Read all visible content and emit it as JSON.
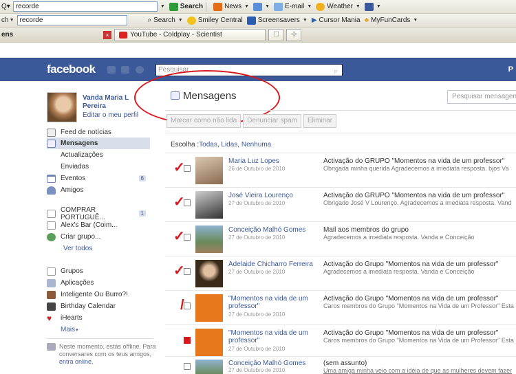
{
  "browser": {
    "toolbar1": {
      "search_value": "recorde",
      "search_btn": "Search",
      "news": "News",
      "email": "E-mail",
      "weather": "Weather"
    },
    "toolbar2": {
      "label_prefix": "ch",
      "search_value": "recorde",
      "search_btn": "Search",
      "smiley": "Smiley Central",
      "screensavers": "Screensavers",
      "cursor": "Cursor Mania",
      "myfun": "MyFunCards"
    },
    "tabbar": {
      "left_text": "ens",
      "tab_title": "YouTube - Coldplay - Scientist"
    },
    "colors": {
      "accent": "#3b5998",
      "highlight_red": "#d9181c"
    }
  },
  "facebook": {
    "logo": "facebook",
    "search_placeholder": "Pesquisar",
    "right_text": "P"
  },
  "profile": {
    "name": "Vanda Maria L Pereira",
    "edit": "Editar o meu perfil"
  },
  "sidebar": {
    "items": [
      {
        "label": "Feed de notícias",
        "icon": "newsfeed-icon"
      },
      {
        "label": "Mensagens",
        "icon": "messages-icon"
      },
      {
        "label": "Actualizações"
      },
      {
        "label": "Enviadas"
      },
      {
        "label": "Eventos",
        "icon": "calendar-icon",
        "count": "6"
      },
      {
        "label": "Amigos",
        "icon": "friends-icon"
      }
    ],
    "groups": [
      {
        "label": "COMPRAR PORTUGUÊ...",
        "count": "1"
      },
      {
        "label": "Alex's Bar (Coim..."
      },
      {
        "label": "Criar grupo..."
      }
    ],
    "see_all": "Ver todos",
    "apps": [
      {
        "label": "Grupos"
      },
      {
        "label": "Aplicações"
      },
      {
        "label": "Inteligente Ou Burro?!"
      },
      {
        "label": "Birthday Calendar"
      },
      {
        "label": "iHearts"
      }
    ],
    "more": "Mais",
    "offline_text": "Neste momento, estás offline. Para conversares com os teus amigos, ",
    "offline_link": "entra online."
  },
  "main": {
    "title": "Mensagens",
    "search_placeholder": "Pesquisar mensagens",
    "actions": [
      "Marcar como não lida",
      "Denunciar spam",
      "Eliminar"
    ],
    "choose_label": "Escolha :",
    "choose_all": "Todas",
    "choose_read": "Lidas",
    "choose_none": "Nenhuma",
    "messages": [
      {
        "sender": "Maria Luz Lopes",
        "date": "26 de Outubro de 2010",
        "subject": "Activação do GRUPO \"Momentos na vida de um professor\"",
        "snippet": "Obrigada minha querida Agradecemos a imediata resposta. bjos Va"
      },
      {
        "sender": "José Vieira Lourenço",
        "date": "27 de Outubro de 2010",
        "subject": "Activação do GRUPO \"Momentos na vida de um professor\"",
        "snippet": "Obrigado José V Lourenço. Agradecemos a imediata resposta. Vand"
      },
      {
        "sender": "Conceição Malhó Gomes",
        "date": "27 de Outubro de 2010",
        "subject": "Mail aos membros do grupo",
        "snippet": "Agradecemos a imediata resposta. Vanda e Conceição"
      },
      {
        "sender": "Adelaide Chicharro Ferreira",
        "date": "27 de Outubro de 2010",
        "subject": "Activação do Grupo \"Momentos na vida de um professor\"",
        "snippet": "Agradecemos a imediata resposta. Vanda e Conceição"
      },
      {
        "sender": "\"Momentos na vida de um professor\"",
        "date": "27 de Outubro de 2010",
        "subject": "Activação do Grupo \"Momentos na vida de um professor\"",
        "snippet": "Caros membros do Grupo \"Momentos na Vida de um Professor\" Esta"
      },
      {
        "sender": "\"Momentos na vida de um professor\"",
        "date": "27 de Outubro de 2010",
        "subject": "Activação do Grupo \"Momentos na vida de um professor\"",
        "snippet": "Caros membros do Grupo \"Momentos na Vida de um Professor\" Esta"
      },
      {
        "sender": "Conceição Malhó Gomes",
        "date": "27 de Outubro de 2010",
        "subject": "(sem assunto)",
        "snippet": "Uma amiga minha veio com a idéia de que as mulheres devem fazer"
      }
    ]
  }
}
